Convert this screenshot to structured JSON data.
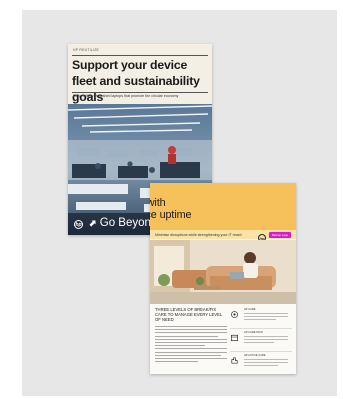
{
  "brochure_1": {
    "kicker": "HP REUTILIZE",
    "title": "Support your device fleet and sustainability goals",
    "subtitle": "HP certified refurbished laptops that promote the circular economy",
    "logo": "hp",
    "footer_tagline": "Go Beyond",
    "footer_with": "with",
    "footer_pill": "Partner Logo"
  },
  "brochure_2": {
    "title": "nd with\nevice uptime",
    "subtitle": "Minimise disruptions while strengthening your IT reach",
    "logo": "hp",
    "pill": "Partner Logo",
    "heading": "THREE LEVELS OF BREAK/FIX CARE TO MANAGE EVERY LEVEL OF NEED",
    "features": [
      {
        "icon": "gear-icon",
        "label": "HP CARE"
      },
      {
        "icon": "box-icon",
        "label": "HP CARE PACK"
      },
      {
        "icon": "hand-icon",
        "label": "HP ACTIVE CARE"
      }
    ]
  },
  "colors": {
    "panel": "#e7e7e7",
    "accent_yellow": "#f6c15a",
    "accent_magenta": "#d61fc8"
  }
}
